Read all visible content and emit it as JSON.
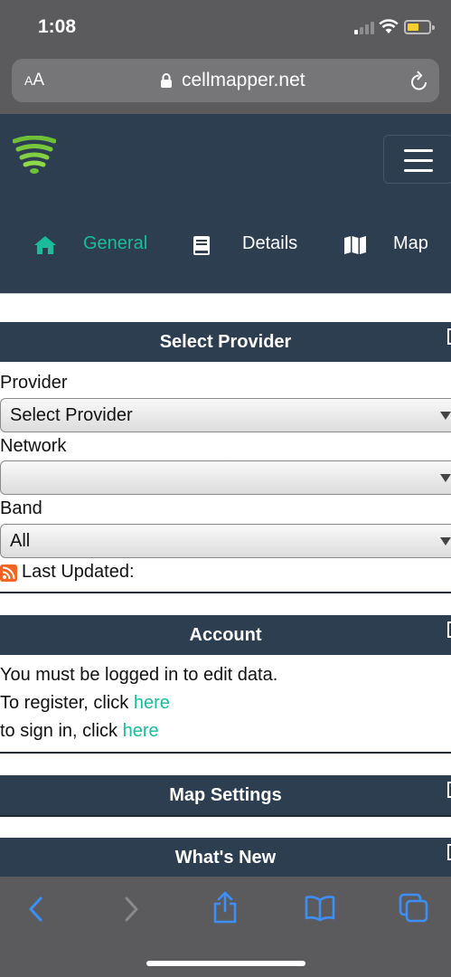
{
  "status_bar": {
    "time": "1:08"
  },
  "browser": {
    "text_size_label_small": "A",
    "text_size_label_large": "A",
    "url": "cellmapper.net"
  },
  "header": {
    "nav": [
      {
        "label": "General",
        "icon": "home-icon",
        "active": true
      },
      {
        "label": "Details",
        "icon": "book-icon",
        "active": false
      },
      {
        "label": "Map",
        "icon": "map-icon",
        "active": false
      }
    ]
  },
  "select_provider": {
    "title": "Select Provider",
    "provider_label": "Provider",
    "provider_value": "Select Provider",
    "network_label": "Network",
    "network_value": "",
    "band_label": "Band",
    "band_value": "All",
    "last_updated_label": "Last Updated:"
  },
  "account": {
    "title": "Account",
    "line1": "You must be logged in to edit data.",
    "line2_prefix": "To register, click ",
    "line2_link": "here",
    "line3_prefix": "to sign in, click ",
    "line3_link": "here"
  },
  "map_settings": {
    "title": "Map Settings"
  },
  "whats_new": {
    "title": "What's New"
  },
  "colors": {
    "header_bg": "#2c3e50",
    "accent": "#1abc9c",
    "browser_chrome": "#5b5b5d"
  }
}
